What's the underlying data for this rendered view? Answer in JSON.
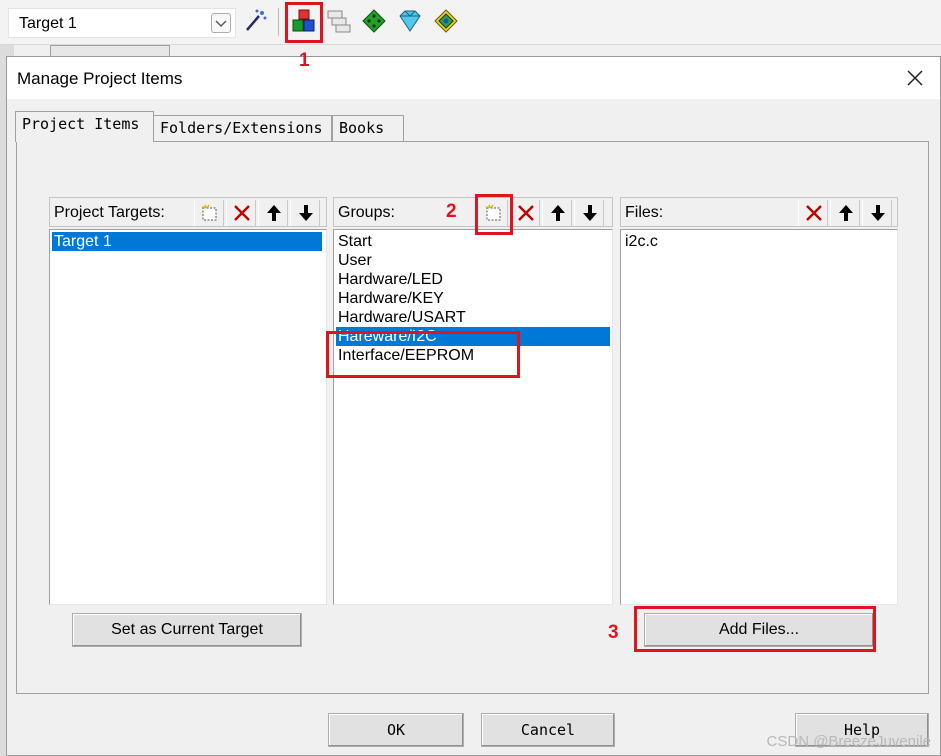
{
  "toolbar": {
    "target_value": "Target 1",
    "icons": [
      "dropdown-chevron-icon",
      "magic-wand-icon",
      "manage-project-items-icon",
      "layers-icon",
      "green-diamond-icon",
      "gem-icon",
      "pack-installer-icon"
    ]
  },
  "dialog": {
    "title": "Manage Project Items",
    "tabs": [
      {
        "label": "Project Items"
      },
      {
        "label": "Folders/Extensions"
      },
      {
        "label": "Books"
      }
    ],
    "targets": {
      "label": "Project Targets:",
      "items": [
        "Target 1"
      ],
      "selected_index": 0
    },
    "groups": {
      "label": "Groups:",
      "items": [
        "Start",
        "User",
        "Hardware/LED",
        "Hardware/KEY",
        "Hardware/USART",
        "Hareware/I2C",
        "Interface/EEPROM"
      ],
      "selected_index": 5
    },
    "files": {
      "label": "Files:",
      "items": [
        "i2c.c"
      ]
    },
    "set_current_target_label": "Set as Current Target",
    "add_files_label": "Add Files...",
    "ok_label": "OK",
    "cancel_label": "Cancel",
    "help_label": "Help"
  },
  "annotations": {
    "labels": [
      "1",
      "2",
      "3"
    ],
    "color": "#e0141e"
  },
  "colors": {
    "selection": "#0078d7"
  },
  "watermark": "CSDN @BreezeJuvenile"
}
